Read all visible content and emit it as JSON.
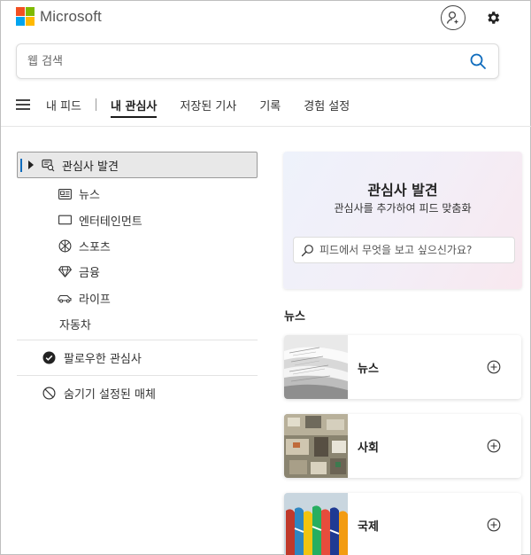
{
  "header": {
    "brand": "Microsoft",
    "logo_colors": [
      "#f25022",
      "#7fba00",
      "#00a4ef",
      "#ffb900"
    ],
    "profile_icon": "person-add-icon",
    "settings_icon": "gear-icon"
  },
  "search": {
    "placeholder": "웹 검색",
    "icon": "search-icon",
    "icon_color": "#0f6cbd"
  },
  "nav": {
    "tabs": [
      {
        "label": "내 피드",
        "active": false
      },
      {
        "label": "내 관심사",
        "active": true
      },
      {
        "label": "저장된 기사",
        "active": false
      },
      {
        "label": "기록",
        "active": false
      },
      {
        "label": "경험 설정",
        "active": false
      }
    ]
  },
  "sidebar": {
    "discover": {
      "label": "관심사 발견",
      "icon": "discover-icon",
      "expanded": true
    },
    "items": [
      {
        "label": "뉴스",
        "icon": "newspaper-icon"
      },
      {
        "label": "엔터테인먼트",
        "icon": "tv-icon"
      },
      {
        "label": "스포츠",
        "icon": "ball-icon"
      },
      {
        "label": "금융",
        "icon": "diamond-icon"
      },
      {
        "label": "라이프",
        "icon": "car-icon"
      },
      {
        "label": "자동차",
        "icon": ""
      }
    ],
    "followed": {
      "label": "팔로우한 관심사",
      "icon": "check-circle-icon"
    },
    "hidden": {
      "label": "숨기기 설정된 매체",
      "icon": "block-icon"
    }
  },
  "discover_card": {
    "title": "관심사 발견",
    "subtitle": "관심사를 추가하여 피드 맞춤화",
    "search_placeholder": "피드에서 무엇을 보고 싶으신가요?"
  },
  "news_section": {
    "title": "뉴스",
    "topics": [
      {
        "name": "뉴스",
        "image": "newspaper-stack-image"
      },
      {
        "name": "사회",
        "image": "city-aerial-image"
      },
      {
        "name": "국제",
        "image": "world-flags-image"
      }
    ],
    "add_icon": "plus-circle-icon"
  }
}
